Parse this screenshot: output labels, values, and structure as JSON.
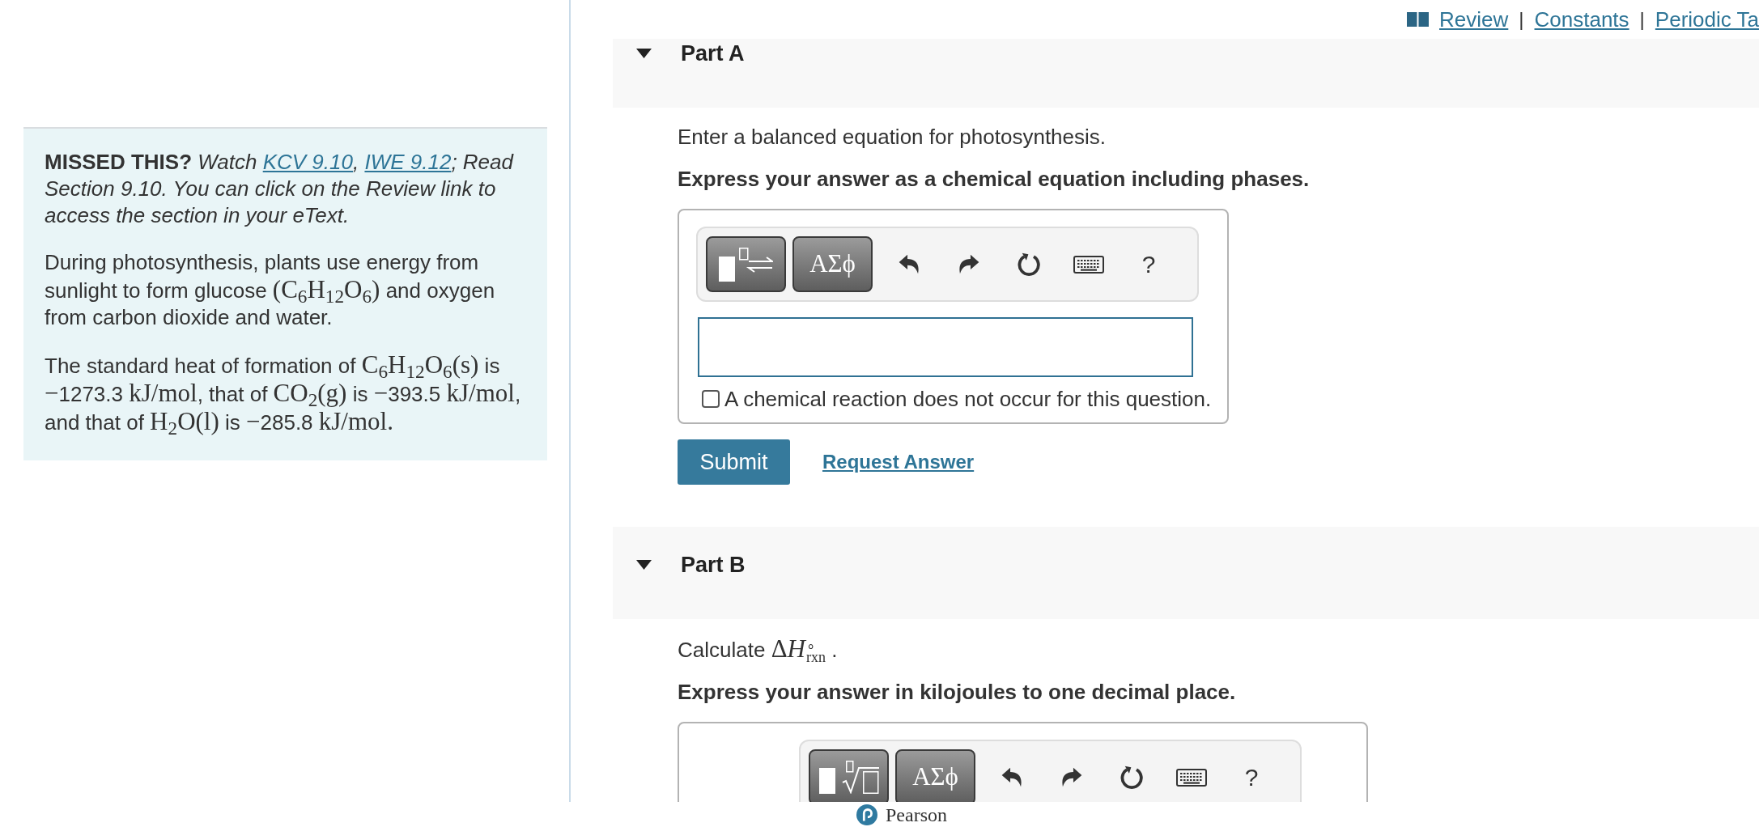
{
  "top_links": [
    {
      "kind": "link",
      "text": "Review"
    },
    {
      "kind": "separator",
      "text": "|"
    },
    {
      "kind": "link",
      "text": "Constants"
    },
    {
      "kind": "separator",
      "text": "|"
    },
    {
      "kind": "link",
      "text": "Periodic Ta"
    }
  ],
  "hint_panel": {
    "paragraphs": [
      [
        {
          "kind": "bold",
          "text": "MISSED THIS?"
        },
        {
          "kind": "italic",
          "text": " Watch "
        },
        {
          "kind": "link",
          "text": "KCV 9.10"
        },
        {
          "kind": "italic",
          "text": ", "
        },
        {
          "kind": "link",
          "text": "IWE 9.12"
        },
        {
          "kind": "italic",
          "text": "; Read Section 9.10. You can click on the Review link to access the section in your eText."
        }
      ],
      [
        {
          "kind": "text",
          "text": "During photosynthesis, plants use energy from sunlight to form glucose "
        },
        {
          "kind": "math",
          "text": "(C$_{6}$H$_{12}$O$_{6}$)"
        },
        {
          "kind": "text",
          "text": " and oxygen from carbon dioxide and water."
        }
      ],
      [
        {
          "kind": "text",
          "text": "The standard heat of formation of "
        },
        {
          "kind": "math",
          "text": "C$_{6}$H$_{12}$O$_{6}$(s)"
        },
        {
          "kind": "text",
          "text": " is "
        },
        {
          "kind": "math",
          "text": "−"
        },
        {
          "kind": "text",
          "text": "1273.3 "
        },
        {
          "kind": "math",
          "text": "kJ/mol"
        },
        {
          "kind": "text",
          "text": ", that of "
        },
        {
          "kind": "math",
          "text": "CO$_{2}$(g)"
        },
        {
          "kind": "text",
          "text": " is "
        },
        {
          "kind": "math",
          "text": "−"
        },
        {
          "kind": "text",
          "text": "393.5 "
        },
        {
          "kind": "math",
          "text": "kJ/mol"
        },
        {
          "kind": "text",
          "text": ", and that of "
        },
        {
          "kind": "math",
          "text": "H$_{2}$O(l)"
        },
        {
          "kind": "text",
          "text": " is "
        },
        {
          "kind": "math",
          "text": "−"
        },
        {
          "kind": "text",
          "text": "285.8 "
        },
        {
          "kind": "math",
          "text": "kJ/mol."
        }
      ]
    ]
  },
  "parts": [
    {
      "title": "Part A",
      "expanded": true,
      "prompt": [
        {
          "kind": "text",
          "text": "Enter a balanced equation for photosynthesis."
        }
      ],
      "instruction": "Express your answer as a chemical equation including phases.",
      "answer": {
        "kind": "equation",
        "toolbar": [
          {
            "kind": "template"
          },
          {
            "kind": "greek",
            "text": "ΑΣϕ"
          },
          {
            "kind": "undo"
          },
          {
            "kind": "redo"
          },
          {
            "kind": "reset"
          },
          {
            "kind": "keyboard"
          },
          {
            "kind": "help",
            "text": "?"
          }
        ],
        "checkbox": {
          "label": "A chemical reaction does not occur for this question.",
          "checked": false
        }
      },
      "actions": {
        "submit": "Submit",
        "request": "Request Answer"
      }
    },
    {
      "title": "Part B",
      "expanded": true,
      "prompt": [
        {
          "kind": "text",
          "text": "Calculate "
        },
        {
          "kind": "math",
          "text": "Δ"
        },
        {
          "kind": "variable",
          "text": "H"
        },
        {
          "kind": "stack",
          "sup": "∘",
          "sub": "rxn"
        },
        {
          "kind": "text",
          "text": " ."
        }
      ],
      "instruction": "Express your answer in kilojoules to one decimal place.",
      "answer": {
        "kind": "numeric",
        "toolbar": [
          {
            "kind": "template"
          },
          {
            "kind": "greek",
            "text": "ΑΣϕ"
          },
          {
            "kind": "undo"
          },
          {
            "kind": "redo"
          },
          {
            "kind": "reset"
          },
          {
            "kind": "keyboard"
          },
          {
            "kind": "help",
            "text": "?"
          }
        ]
      }
    }
  ],
  "footer": {
    "logo_text": "Pearson"
  }
}
